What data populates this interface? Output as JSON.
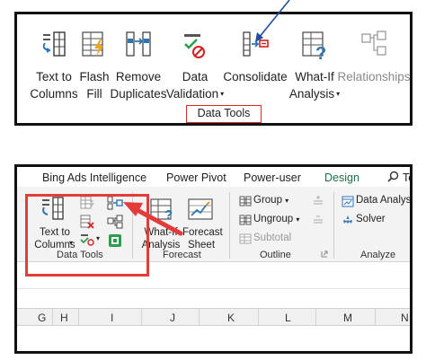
{
  "top_ribbon": {
    "buttons": [
      {
        "id": "text-to-columns",
        "label": "Text to\nColumns"
      },
      {
        "id": "flash-fill",
        "label": "Flash\nFill"
      },
      {
        "id": "remove-duplicates",
        "label": "Remove\nDuplicates"
      },
      {
        "id": "data-validation",
        "label_line1": "Data",
        "label_line2": "Validation"
      },
      {
        "id": "consolidate",
        "label": "Consolidate"
      },
      {
        "id": "what-if-analysis",
        "label_line1": "What-If",
        "label_line2": "Analysis"
      },
      {
        "id": "relationships",
        "label": "Relationships"
      }
    ],
    "group_label": "Data Tools"
  },
  "bottom_ribbon": {
    "tabs": [
      "Bing Ads Intelligence",
      "Power Pivot",
      "Power-user",
      "Design",
      "Te"
    ],
    "active_tab": "Design",
    "data_tools": {
      "text_to_columns": "Text to\nColumns",
      "group_label": "Data Tools"
    },
    "forecast": {
      "what_if": "What-If\nAnalysis",
      "forecast_sheet": "Forecast\nSheet",
      "group_label": "Forecast"
    },
    "outline": {
      "group": "Group",
      "ungroup": "Ungroup",
      "subtotal": "Subtotal",
      "group_label": "Outline"
    },
    "analyze": {
      "data_analysis": "Data Analysis",
      "solver": "Solver",
      "group_label": "Analyze"
    }
  },
  "sheet": {
    "column_headers": [
      "G",
      "H",
      "I",
      "J",
      "K",
      "L",
      "M",
      "N"
    ]
  },
  "colors": {
    "accent_red": "#e43b3b",
    "excel_green": "#1e7145",
    "arrow_blue": "#1f4e9e",
    "icon_blue": "#2e75b6"
  }
}
